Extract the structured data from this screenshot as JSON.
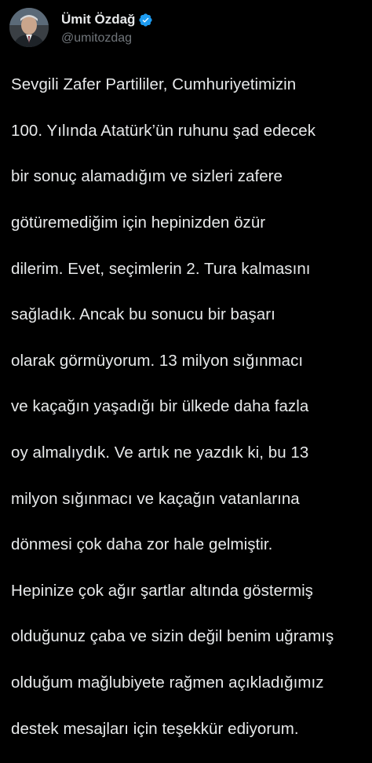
{
  "tweet": {
    "author": {
      "display_name": "Ümit Özdağ",
      "handle": "@umitozdag",
      "verified": true,
      "verified_color": "#1d9bf0"
    },
    "text_lines": [
      "Sevgili Zafer Partililer, Cumhuriyetimizin",
      "100. Yılında Atatürk’ün ruhunu şad edecek",
      "bir sonuç alamadığım ve sizleri zafere",
      "götüremediğim için hepinizden özür",
      "dilerim. Evet, seçimlerin 2. Tura kalmasını",
      "sağladık. Ancak bu sonucu bir başarı",
      "olarak görmüyorum. 13 milyon sığınmacı",
      "ve kaçağın yaşadığı bir ülkede daha fazla",
      "oy almalıydık. Ve artık ne yazdık ki, bu 13",
      "milyon sığınmacı ve kaçağın vatanlarına",
      "dönmesi çok daha zor hale gelmiştir.",
      "Hepinize çok ağır şartlar altında göstermiş",
      "olduğunuz çaba ve sizin değil benim uğramış",
      "olduğum mağlubiyete rağmen açıkladığımız",
      "destek mesajları için teşekkür ediyorum."
    ]
  },
  "theme": {
    "background": "#000000",
    "text": "#e7e9ea",
    "secondary_text": "#71767b"
  },
  "icons": {
    "avatar": "profile-photo",
    "verified": "verified-badge-icon"
  }
}
